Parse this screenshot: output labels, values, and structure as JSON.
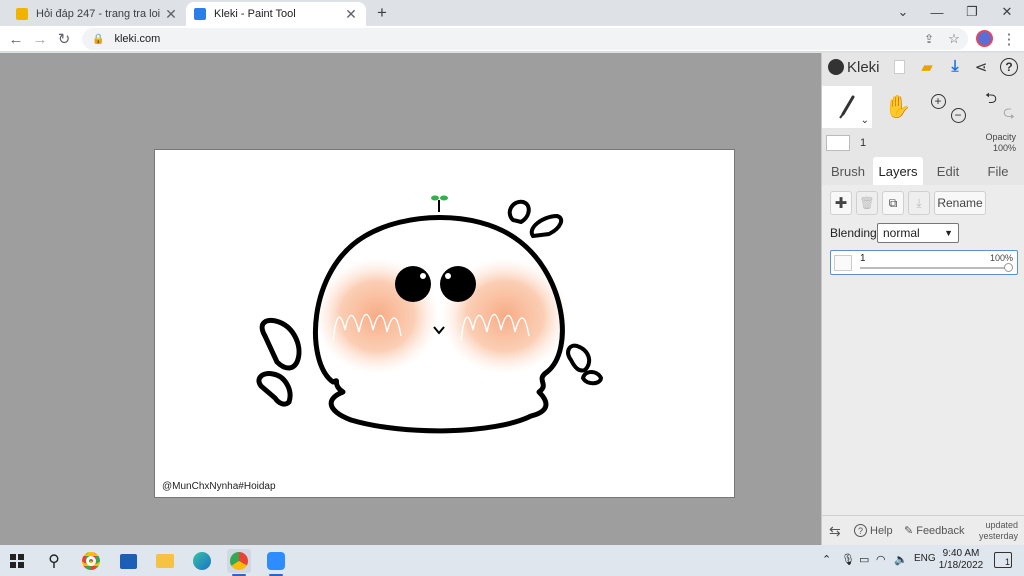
{
  "browser": {
    "tabs": [
      {
        "title": "Hỏi đáp 247 - trang tra loi",
        "favicon_color": "#f0b400",
        "active": false
      },
      {
        "title": "Kleki - Paint Tool",
        "favicon_color": "#2b7de9",
        "active": true
      }
    ],
    "new_tab": "+",
    "url": "kleki.com"
  },
  "canvas": {
    "signature": "@MunChxNynha#Hoidap"
  },
  "kleki": {
    "logo": "Kleki",
    "brush_size": "1",
    "opacity_label": "Opacity",
    "opacity_value": "100%",
    "tabs": [
      "Brush",
      "Layers",
      "Edit",
      "File"
    ],
    "active_tab": "Layers",
    "rename_label": "Rename",
    "blending_label": "Blending",
    "blending_value": "normal",
    "layer": {
      "name": "1",
      "opacity": "100%"
    },
    "footer": {
      "help": "Help",
      "feedback": "Feedback",
      "updated_line1": "updated",
      "updated_line2": "yesterday"
    },
    "accent": "#1a73e8"
  },
  "taskbar": {
    "language": "ENG",
    "time": "9:40 AM",
    "date": "1/18/2022",
    "notifications": "1"
  }
}
